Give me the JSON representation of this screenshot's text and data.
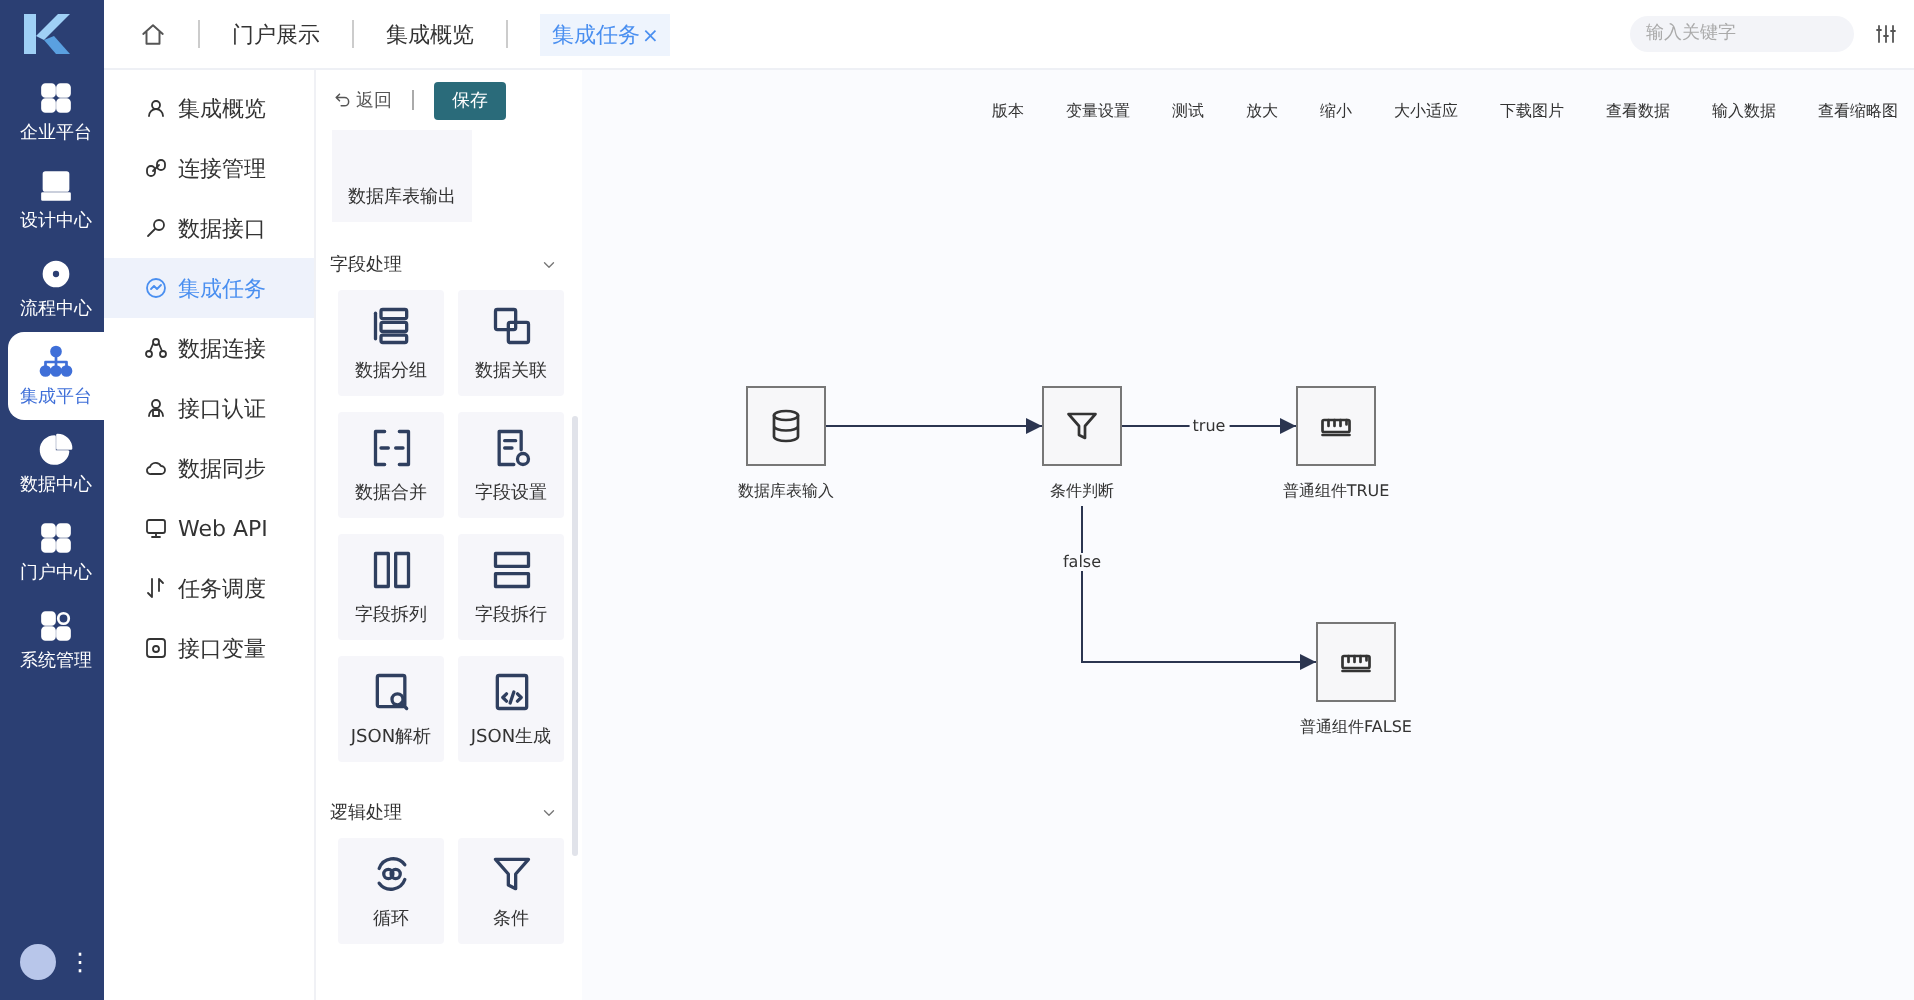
{
  "rail": {
    "items": [
      {
        "label": "企业平台",
        "selected": false
      },
      {
        "label": "设计中心",
        "selected": false
      },
      {
        "label": "流程中心",
        "selected": false
      },
      {
        "label": "集成平台",
        "selected": true
      },
      {
        "label": "数据中心",
        "selected": false
      },
      {
        "label": "门户中心",
        "selected": false
      },
      {
        "label": "系统管理",
        "selected": false
      }
    ],
    "more": "⋮"
  },
  "tabs": [
    {
      "label": "门户展示",
      "selected": false,
      "closable": false
    },
    {
      "label": "集成概览",
      "selected": false,
      "closable": false
    },
    {
      "label": "集成任务",
      "selected": true,
      "closable": true,
      "close": "×"
    }
  ],
  "search": {
    "placeholder": "输入关键字"
  },
  "menu": {
    "items": [
      {
        "label": "集成概览",
        "selected": false
      },
      {
        "label": "连接管理",
        "selected": false
      },
      {
        "label": "数据接口",
        "selected": false
      },
      {
        "label": "集成任务",
        "selected": true
      },
      {
        "label": "数据连接",
        "selected": false
      },
      {
        "label": "接口认证",
        "selected": false
      },
      {
        "label": "数据同步",
        "selected": false
      },
      {
        "label": "Web API",
        "selected": false
      },
      {
        "label": "任务调度",
        "selected": false
      },
      {
        "label": "接口变量",
        "selected": false
      }
    ]
  },
  "editor_toolbar": {
    "back": "返回",
    "save": "保存",
    "actions": [
      "版本",
      "变量设置",
      "测试",
      "放大",
      "缩小",
      "大小适应",
      "下载图片",
      "查看数据",
      "输入数据",
      "查看缩略图"
    ]
  },
  "palette": {
    "top_item": "数据库表输出",
    "sections": [
      {
        "title": "字段处理",
        "expanded": true,
        "items": [
          "数据分组",
          "数据关联",
          "数据合并",
          "字段设置",
          "字段拆列",
          "字段拆行",
          "JSON解析",
          "JSON生成"
        ]
      },
      {
        "title": "逻辑处理",
        "expanded": true,
        "items": [
          "循环",
          "条件"
        ]
      }
    ]
  },
  "canvas": {
    "nodes": [
      {
        "label": "数据库表输入",
        "kind": "database"
      },
      {
        "label": "条件判断",
        "kind": "filter"
      },
      {
        "label": "普通组件TRUE",
        "kind": "component"
      },
      {
        "label": "普通组件FALSE",
        "kind": "component"
      }
    ],
    "edges": [
      {
        "kind": "straight"
      },
      {
        "kind": "straight",
        "label": "true"
      },
      {
        "kind": "elbow",
        "label": "false"
      }
    ]
  }
}
